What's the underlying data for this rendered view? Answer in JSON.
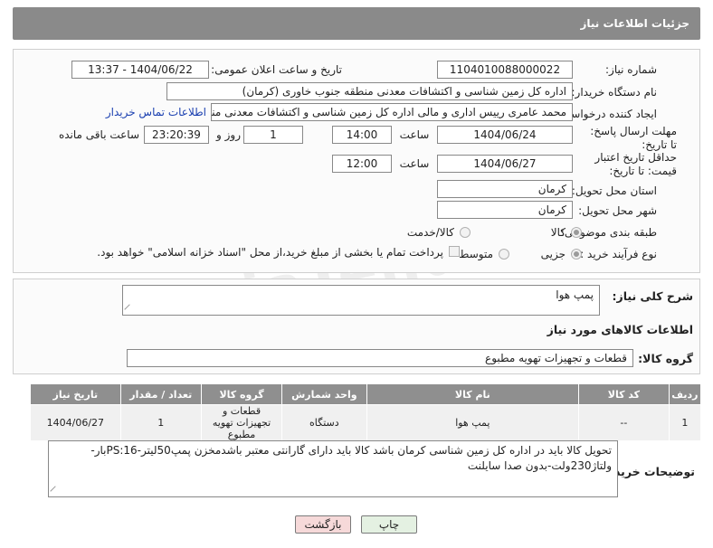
{
  "header": {
    "title": "جزئیات اطلاعات نیاز"
  },
  "form": {
    "need_number_label": "شماره نیاز:",
    "need_number": "1104010088000022",
    "announce_label": "تاریخ و ساعت اعلان عمومی:",
    "announce_value": "1404/06/22 - 13:37",
    "buyer_org_label": "نام دستگاه خریدار:",
    "buyer_org": "اداره کل زمین شناسی و اکتشافات معدنی منطقه جنوب خاوری (کرمان)",
    "requester_label": "ایجاد کننده درخواست:",
    "requester": "محمد  عامری رییس اداری و مالی اداره کل زمین شناسی و اکتشافات معدنی منطقه",
    "buyer_contact_link": "اطلاعات تماس خریدار",
    "reply_deadline_label": "مهلت ارسال پاسخ: تا تاریخ:",
    "reply_date": "1404/06/24",
    "time_label": "ساعت",
    "reply_time": "14:00",
    "days_value": "1",
    "days_label": "روز و",
    "remaining_time": "23:20:39",
    "remaining_label": "ساعت باقی مانده",
    "price_validity_label": "حداقل تاریخ اعتبار قیمت: تا تاریخ:",
    "price_date": "1404/06/27",
    "price_time": "12:00",
    "province_label": "استان محل تحویل:",
    "province": "کرمان",
    "city_label": "شهر محل تحویل:",
    "city": "کرمان",
    "category_label": "طبقه بندی موضوعی:",
    "category_goods": "کالا",
    "category_service": "کالا/خدمت",
    "category_selected": "کالا",
    "process_label": "نوع فرآیند خرید :",
    "process_partial": "جزیی",
    "process_medium": "متوسط",
    "process_selected": "جزیی",
    "payment_note": "پرداخت تمام یا بخشی از مبلغ خرید،از محل \"اسناد خزانه اسلامی\" خواهد بود."
  },
  "description": {
    "label": "شرح کلی نیاز:",
    "value": "پمپ هوا"
  },
  "goods": {
    "section_title": "اطلاعات کالاهای مورد نیاز",
    "group_label": "گروه کالا:",
    "group_value": "قطعات و تجهیزات تهویه مطبوع",
    "columns": [
      "ردیف",
      "کد کالا",
      "نام کالا",
      "واحد شمارش",
      "گروه کالا",
      "تعداد / مقدار",
      "تاریخ نیاز"
    ],
    "rows": [
      {
        "row": "1",
        "code": "--",
        "name": "پمپ هوا",
        "unit": "دستگاه",
        "group": "قطعات و تجهیزات تهویه مطبوع",
        "qty": "1",
        "date": "1404/06/27"
      }
    ]
  },
  "buyer_notes": {
    "label": "توضیحات خریدار:",
    "value": "تحویل کالا باید در اداره کل زمین شناسی کرمان باشد کالا باید دارای گارانتی معتبر باشدمخزن پمپ50لیتر-PS:16بار-ولتاژ230ولت-بدون صدا سایلنت"
  },
  "actions": {
    "print_label": "چاپ",
    "back_label": "بازگشت"
  },
  "watermark": "AriaTender.neT",
  "colors": {
    "header_bg": "#8a8a8a",
    "link": "#1a3fb0",
    "back_button_bg": "#f6d9d9",
    "print_button_bg": "#e4f1e2"
  }
}
